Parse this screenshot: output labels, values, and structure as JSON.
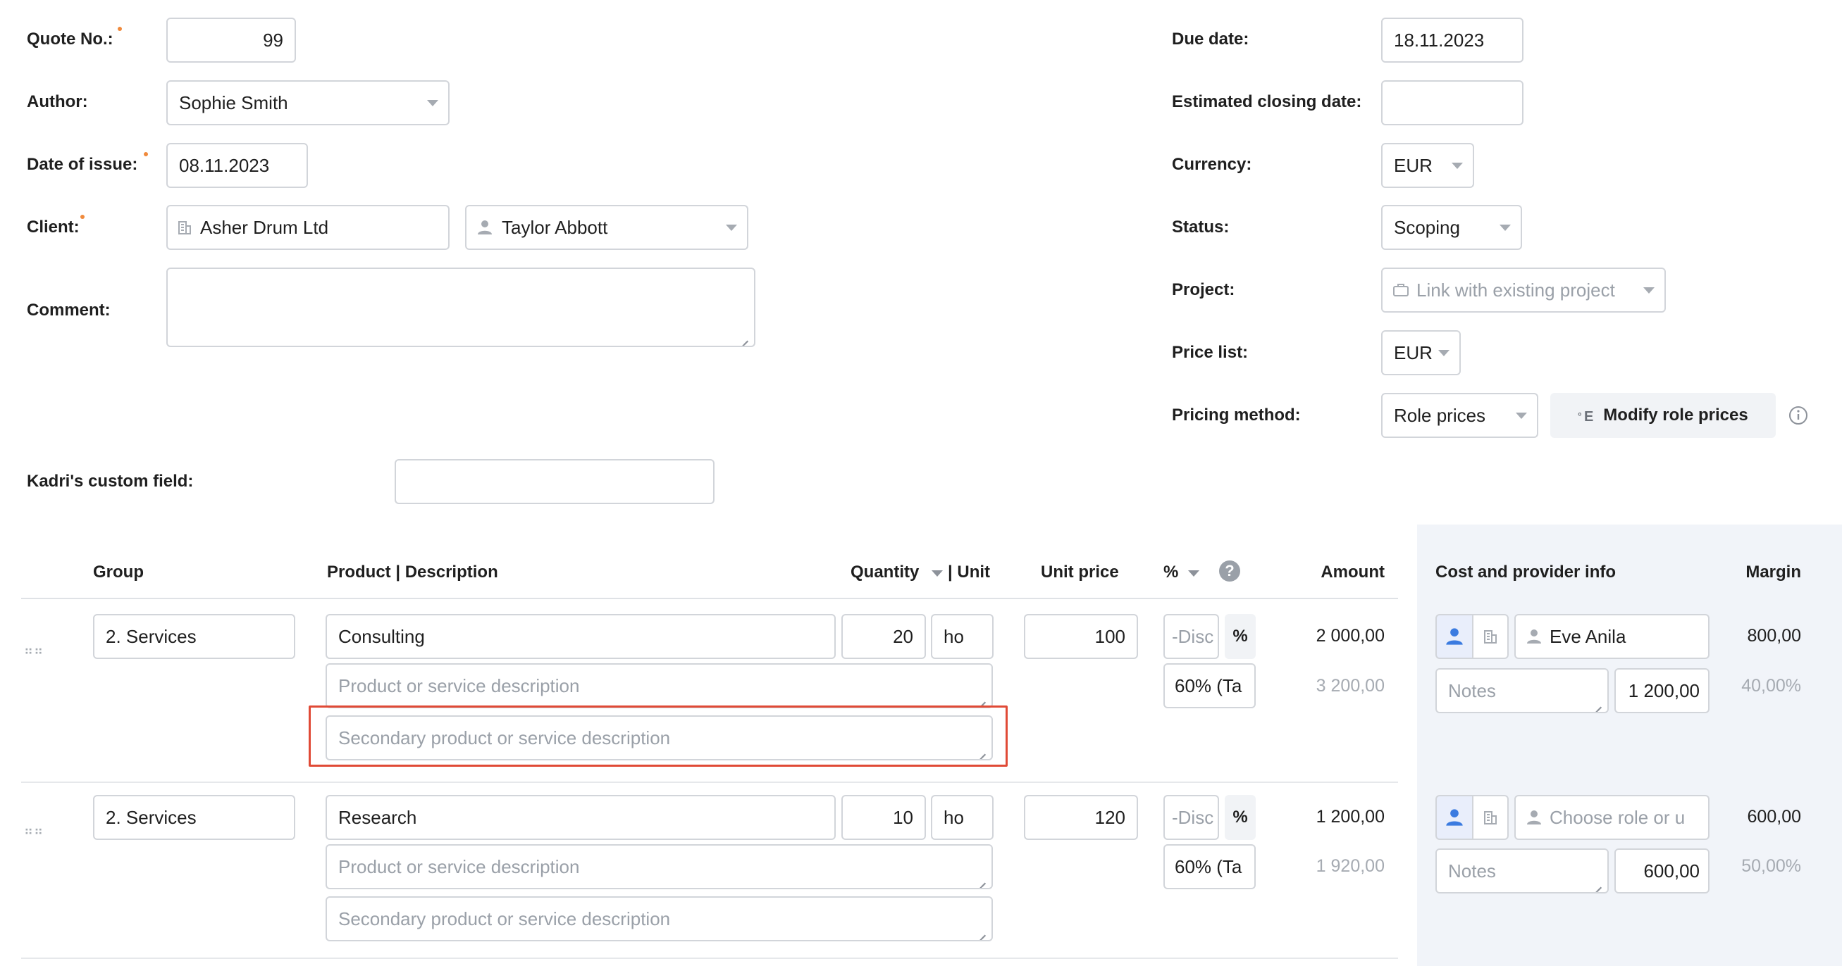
{
  "header": {
    "quote_no_label": "Quote No.:",
    "quote_no_value": "99",
    "author_label": "Author:",
    "author_value": "Sophie Smith",
    "date_of_issue_label": "Date of issue:",
    "date_of_issue_value": "08.11.2023",
    "client_label": "Client:",
    "client_company": "Asher Drum Ltd",
    "client_contact": "Taylor Abbott",
    "comment_label": "Comment:",
    "comment_value": "",
    "custom_field_label": "Kadri's custom field:",
    "custom_field_value": "",
    "due_date_label": "Due date:",
    "due_date_value": "18.11.2023",
    "closing_date_label": "Estimated closing date:",
    "closing_date_value": "",
    "currency_label": "Currency:",
    "currency_value": "EUR",
    "status_label": "Status:",
    "status_value": "Scoping",
    "project_label": "Project:",
    "project_placeholder": "Link with existing project",
    "price_list_label": "Price list:",
    "price_list_value": "EUR",
    "pricing_method_label": "Pricing method:",
    "pricing_method_value": "Role prices",
    "modify_role_prices_label": "Modify role prices"
  },
  "table": {
    "columns": {
      "group": "Group",
      "product": "Product | Description",
      "quantity": "Quantity",
      "unit": "| Unit",
      "unit_price": "Unit price",
      "percent": "%",
      "help": "?",
      "amount": "Amount",
      "cost_info": "Cost and provider info",
      "margin": "Margin"
    },
    "rows": [
      {
        "group": "2. Services",
        "product": "Consulting",
        "description_placeholder": "Product or service description",
        "secondary_placeholder": "Secondary product or service description",
        "quantity": "20",
        "unit": "ho",
        "unit_price": "100",
        "discount_placeholder": "-Disc",
        "percent_sign": "%",
        "tax": "60% (Ta",
        "amount": "2 000,00",
        "amount_with_tax": "3 200,00",
        "provider": "Eve Anila",
        "provider_is_placeholder": false,
        "notes_placeholder": "Notes",
        "cost": "1 200,00",
        "margin": "800,00",
        "margin_percent": "40,00%"
      },
      {
        "group": "2. Services",
        "product": "Research",
        "description_placeholder": "Product or service description",
        "secondary_placeholder": "Secondary product or service description",
        "quantity": "10",
        "unit": "ho",
        "unit_price": "120",
        "discount_placeholder": "-Disc",
        "percent_sign": "%",
        "tax": "60% (Ta",
        "amount": "1 200,00",
        "amount_with_tax": "1 920,00",
        "provider": "Choose role or u",
        "provider_is_placeholder": true,
        "notes_placeholder": "Notes",
        "cost": "600,00",
        "margin": "600,00",
        "margin_percent": "50,00%"
      }
    ]
  },
  "colors": {
    "accent_blue": "#3b7be0",
    "required_dot": "#f08a3c",
    "highlight_red": "#e04a36",
    "side_panel_bg": "#f1f4f9",
    "border": "#d2d5da"
  }
}
